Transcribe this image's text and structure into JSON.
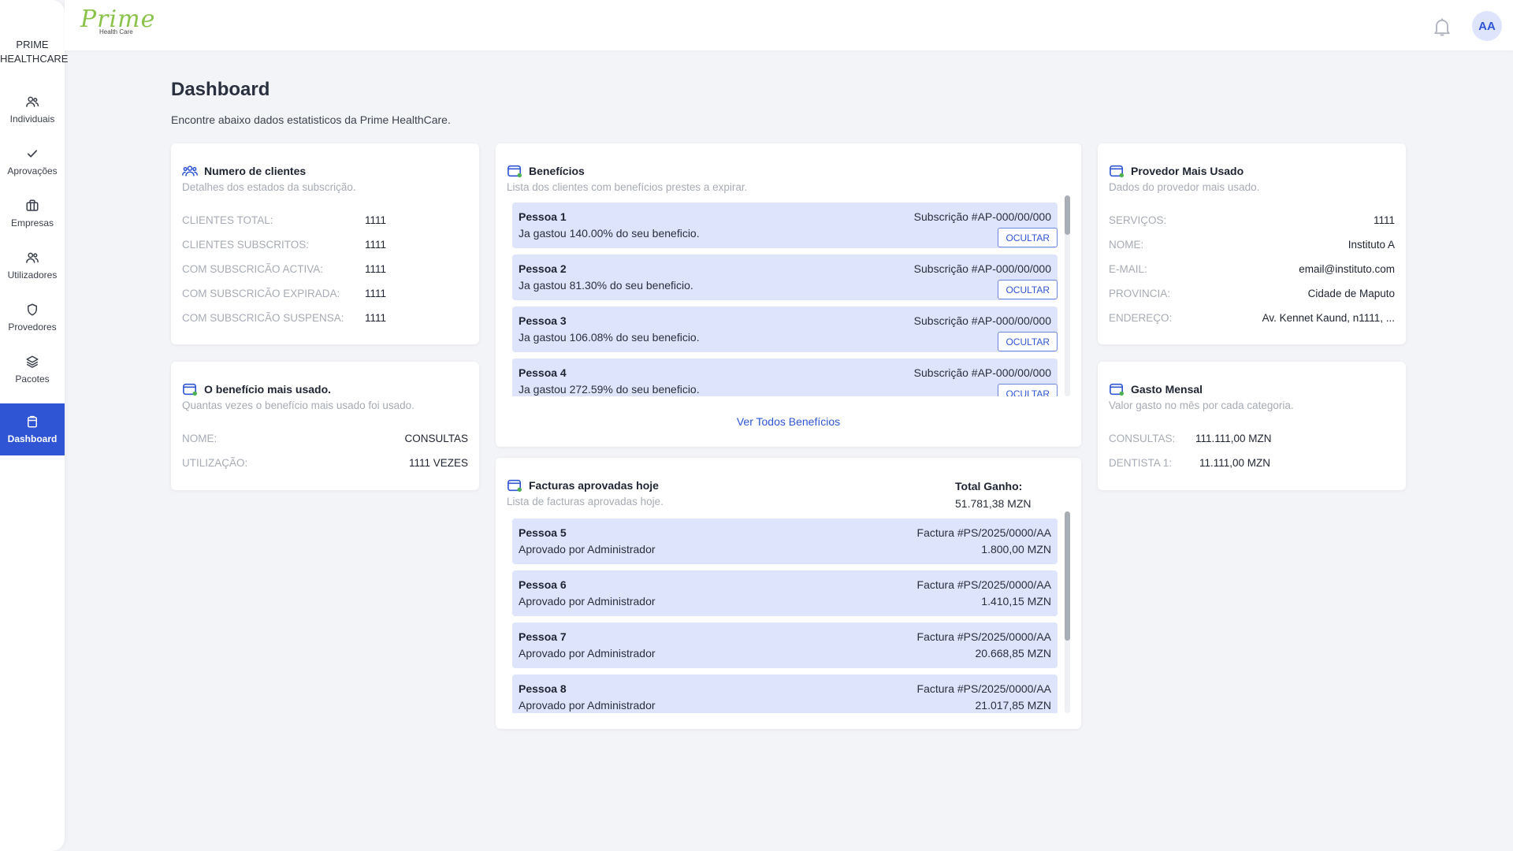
{
  "brand": {
    "line1": "PRIME",
    "line2": "HEALTHCARE"
  },
  "logo": {
    "main": "Prime",
    "sub": "Health Care"
  },
  "nav": [
    {
      "label": "Individuais",
      "icon": "users-icon"
    },
    {
      "label": "Aprovações",
      "icon": "check-icon"
    },
    {
      "label": "Empresas",
      "icon": "briefcase-icon"
    },
    {
      "label": "Utilizadores",
      "icon": "user-group-icon"
    },
    {
      "label": "Provedores",
      "icon": "shield-icon"
    },
    {
      "label": "Pacotes",
      "icon": "layers-icon"
    },
    {
      "label": "Dashboard",
      "icon": "clipboard-icon",
      "active": true
    }
  ],
  "header": {
    "avatar": "AA"
  },
  "page": {
    "title": "Dashboard",
    "subtitle": "Encontre abaixo dados estatisticos da Prime HealthCare."
  },
  "clients": {
    "title": "Numero de clientes",
    "desc": "Detalhes dos estados da subscrição.",
    "rows": [
      {
        "label": "CLIENTES TOTAL:",
        "value": "1111"
      },
      {
        "label": "CLIENTES SUBSCRITOS:",
        "value": "1111"
      },
      {
        "label": "COM SUBSCRICÃO ACTIVA:",
        "value": "1111"
      },
      {
        "label": "COM SUBSCRICÃO EXPIRADA:",
        "value": "1111"
      },
      {
        "label": "COM SUBSCRICÃO SUSPENSA:",
        "value": "1111"
      }
    ]
  },
  "topBenefit": {
    "title": "O benefício mais usado.",
    "desc": "Quantas vezes o benefício mais usado foi usado.",
    "rows": [
      {
        "label": "NOME:",
        "value": "CONSULTAS"
      },
      {
        "label": "UTILIZAÇÃO:",
        "value": "1111 VEZES"
      }
    ]
  },
  "benefits": {
    "title": "Benefícios",
    "desc": "Lista dos clientes com benefícios prestes a expirar.",
    "hide_label": "OCULTAR",
    "see_all": "Ver Todos Benefícios",
    "items": [
      {
        "name": "Pessoa 1",
        "desc": "Ja gastou 140.00% do seu beneficio.",
        "sub": "Subscrição #AP-000/00/000"
      },
      {
        "name": "Pessoa 2",
        "desc": "Ja gastou 81.30% do seu beneficio.",
        "sub": "Subscrição #AP-000/00/000"
      },
      {
        "name": "Pessoa 3",
        "desc": "Ja gastou 106.08% do seu beneficio.",
        "sub": "Subscrição #AP-000/00/000"
      },
      {
        "name": "Pessoa 4",
        "desc": "Ja gastou 272.59% do seu beneficio.",
        "sub": "Subscrição #AP-000/00/000"
      }
    ]
  },
  "invoices": {
    "title": "Facturas aprovadas hoje",
    "desc": "Lista de facturas aprovadas hoje.",
    "total_label": "Total Ganho:",
    "total_value": "51.781,38 MZN",
    "items": [
      {
        "name": "Pessoa 5",
        "desc": "Aprovado por Administrador",
        "invoice": "Factura #PS/2025/0000/AA",
        "amount": "1.800,00 MZN"
      },
      {
        "name": "Pessoa 6",
        "desc": "Aprovado por Administrador",
        "invoice": "Factura #PS/2025/0000/AA",
        "amount": "1.410,15 MZN"
      },
      {
        "name": "Pessoa 7",
        "desc": "Aprovado por Administrador",
        "invoice": "Factura #PS/2025/0000/AA",
        "amount": "20.668,85 MZN"
      },
      {
        "name": "Pessoa 8",
        "desc": "Aprovado por Administrador",
        "invoice": "Factura #PS/2025/0000/AA",
        "amount": "21.017,85 MZN"
      }
    ]
  },
  "provider": {
    "title": "Provedor Mais Usado",
    "desc": "Dados do provedor mais usado.",
    "rows": [
      {
        "label": "SERVIÇOS:",
        "value": "1111"
      },
      {
        "label": "NOME:",
        "value": "Instituto A"
      },
      {
        "label": "E-MAIL:",
        "value": "email@instituto.com"
      },
      {
        "label": "PROVINCIA:",
        "value": "Cidade de Maputo"
      },
      {
        "label": "ENDEREÇO:",
        "value": "Av. Kennet Kaund, n1111, ..."
      }
    ]
  },
  "monthly": {
    "title": "Gasto Mensal",
    "desc": "Valor gasto no mês por cada categoria.",
    "rows": [
      {
        "label": "CONSULTAS:",
        "value": "111.111,00 MZN"
      },
      {
        "label": "DENTISTA 1:",
        "value": "11.111,00 MZN"
      }
    ]
  },
  "colors": {
    "accent": "#2f55d4",
    "itemBg": "#dde4fb",
    "logoGreen": "#8bc34a",
    "muted": "#a6abb6"
  }
}
